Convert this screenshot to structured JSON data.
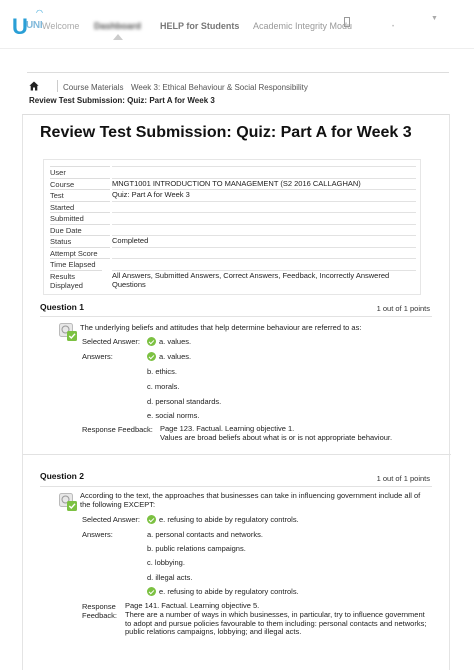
{
  "nav": {
    "logo_letter": "U",
    "logo_text": "UNI",
    "welcome": "Welcome",
    "dashboard": "Dashboard",
    "help": "HELP for Students",
    "academic": "Academic Integrity Modu"
  },
  "breadcrumb": {
    "course_materials": "Course Materials",
    "week": "Week 3: Ethical Behaviour & Social Responsibility",
    "current": "Review Test Submission: Quiz: Part A for Week 3"
  },
  "page_title": "Review Test Submission: Quiz: Part A for Week 3",
  "details": [
    {
      "label": "User",
      "value": ""
    },
    {
      "label": "Course",
      "value": "MNGT1001 INTRODUCTION TO MANAGEMENT (S2 2016 CALLAGHAN)"
    },
    {
      "label": "Test",
      "value": "Quiz: Part A for Week 3"
    },
    {
      "label": "Started",
      "value": ""
    },
    {
      "label": "Submitted",
      "value": ""
    },
    {
      "label": "Due Date",
      "value": ""
    },
    {
      "label": "Status",
      "value": "Completed"
    },
    {
      "label": "Attempt Score",
      "value": ""
    },
    {
      "label": "Time Elapsed",
      "value": ""
    },
    {
      "label": "Results Displayed",
      "value": "All Answers, Submitted Answers, Correct Answers, Feedback, Incorrectly Answered Questions"
    }
  ],
  "labels": {
    "selected_answer": "Selected Answer:",
    "answers": "Answers:",
    "response_feedback": "Response Feedback:",
    "response": "Response",
    "feedback": "Feedback:"
  },
  "questions": [
    {
      "title": "Question 1",
      "points": "1 out of 1 points",
      "text": "The underlying beliefs and attitudes that help determine behaviour are referred to as:",
      "selected": "a. values.",
      "answers": [
        "a. values.",
        "b. ethics.",
        "c. morals.",
        "d. personal standards.",
        "e. social norms."
      ],
      "feedback_1": "Page 123. Factual. Learning objective 1.",
      "feedback_2": "Values are broad beliefs about what is or is not appropriate behaviour."
    },
    {
      "title": "Question 2",
      "points": "1 out of 1 points",
      "text": "According to the text, the approaches that businesses can take in influencing government include all of the following EXCEPT:",
      "selected": "e. refusing to abide by regulatory controls.",
      "answers": [
        "a. personal contacts and networks.",
        "b. public relations campaigns.",
        "c. lobbying.",
        "d. illegal acts.",
        "e. refusing to abide by regulatory controls."
      ],
      "feedback_1": "Page 141. Factual. Learning objective 5.",
      "feedback_2": "There are a number of ways in which businesses, in particular, try to influence government to adopt and pursue policies favourable to them including: personal contacts and networks; public relations campaigns, lobbying; and illegal acts."
    }
  ],
  "colors": {
    "accent_blue": "#2a9fd6",
    "check_green": "#7cc142"
  }
}
